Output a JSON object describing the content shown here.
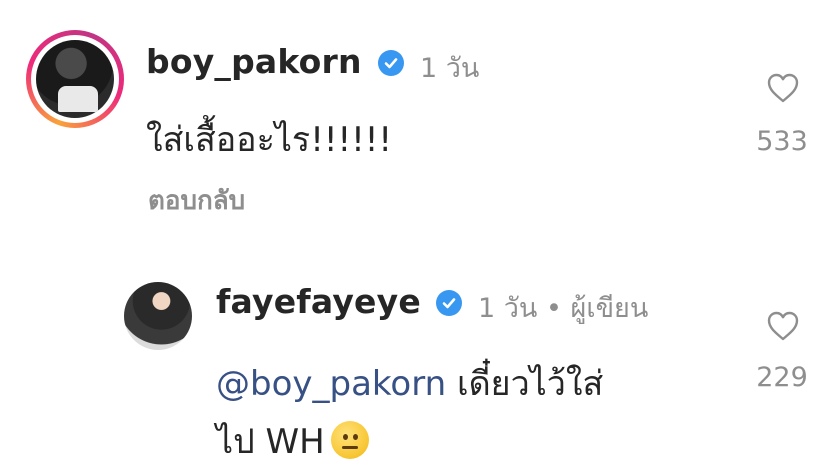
{
  "comments": [
    {
      "username": "boy_pakorn",
      "time": "1 วัน",
      "text": "ใส่เสื้ออะไร!!!!!!",
      "reply_label": "ตอบกลับ",
      "likes": "533"
    }
  ],
  "replies": [
    {
      "username": "fayefayeye",
      "time": "1 วัน",
      "separator": "•",
      "role": "ผู้เขียน",
      "mention": "@boy_pakorn",
      "text_line1": "เดี๋ยวไว้ใส่",
      "text_line2": "ไป WH",
      "likes": "229"
    }
  ],
  "icons": {
    "verified": "verified-badge-icon",
    "like": "heart-outline-icon",
    "emoji": "neutral-face-emoji"
  },
  "colors": {
    "verified": "#3897f0",
    "mention": "#385185",
    "muted": "#8e8e8e",
    "text": "#262626"
  }
}
